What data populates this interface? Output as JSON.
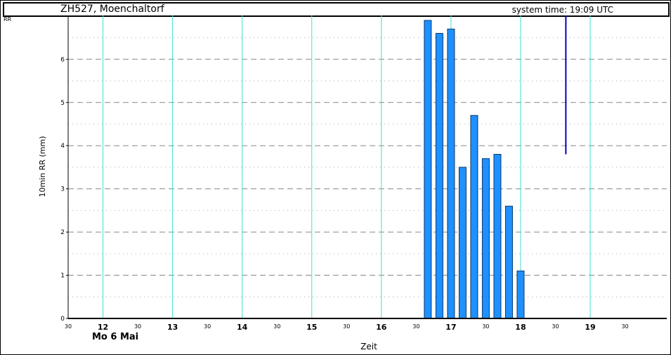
{
  "header": {
    "station": "ZH527, Moenchaltorf",
    "system_time": "system time:  19:09 UTC"
  },
  "chart_data": {
    "type": "bar",
    "corner_label": "RR",
    "ylabel": "10min RR (mm)",
    "xlabel": "Zeit",
    "date_label": "Mo 6 Mai",
    "ylim": [
      0,
      7
    ],
    "y_ticks": [
      0,
      1,
      2,
      3,
      4,
      5,
      6
    ],
    "xlim_hours": [
      11.5,
      20.1
    ],
    "hour_ticks": [
      "12",
      "13",
      "14",
      "15",
      "16",
      "17",
      "18",
      "19"
    ],
    "half_ticks": [
      "30",
      "30",
      "30",
      "30",
      "30",
      "30",
      "30",
      "30",
      "30"
    ],
    "grid": true,
    "current_time_hour": 18.65,
    "bar_color": "#1e90ff",
    "grid_color": "#40e0d0",
    "marker_color": "#0000cc",
    "x": [
      "16:40",
      "16:50",
      "17:00",
      "17:10",
      "17:20",
      "17:30",
      "17:40",
      "17:50",
      "18:00"
    ],
    "values": [
      6.9,
      6.6,
      6.7,
      3.5,
      4.7,
      3.7,
      3.8,
      2.6,
      1.1
    ]
  }
}
